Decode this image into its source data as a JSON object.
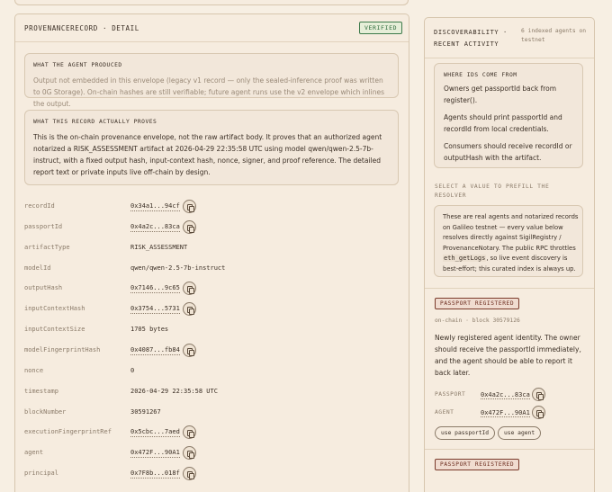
{
  "detail": {
    "title": "PROVENANCERECORD · DETAIL",
    "status": "VERIFIED",
    "produced": {
      "heading": "WHAT THE AGENT PRODUCED",
      "text": "Output not embedded in this envelope (legacy v1 record — only the sealed-inference proof was written to 0G Storage). On-chain hashes are still verifiable; future agent runs use the v2 envelope which inlines the output."
    },
    "proves": {
      "heading": "WHAT THIS RECORD ACTUALLY PROVES",
      "text": "This is the on-chain provenance envelope, not the raw artifact body. It proves that an authorized agent notarized a RISK_ASSESSMENT artifact at 2026-04-29 22:35:58 UTC using model qwen/qwen-2.5-7b-instruct, with a fixed output hash, input-context hash, nonce, signer, and proof reference. The detailed report text or private inputs live off-chain by design."
    },
    "fields": [
      {
        "key": "recordId",
        "value": "0x34a1...94cf",
        "copy": true
      },
      {
        "key": "passportId",
        "value": "0x4a2c...83ca",
        "copy": true
      },
      {
        "key": "artifactType",
        "value": "RISK_ASSESSMENT",
        "copy": false
      },
      {
        "key": "modelId",
        "value": "qwen/qwen-2.5-7b-instruct",
        "copy": false
      },
      {
        "key": "outputHash",
        "value": "0x7146...9c65",
        "copy": true
      },
      {
        "key": "inputContextHash",
        "value": "0x3754...5731",
        "copy": true
      },
      {
        "key": "inputContextSize",
        "value": "1705 bytes",
        "copy": false
      },
      {
        "key": "modelFingerprintHash",
        "value": "0x4087...fb84",
        "copy": true
      },
      {
        "key": "nonce",
        "value": "0",
        "copy": false
      },
      {
        "key": "timestamp",
        "value": "2026-04-29 22:35:58 UTC",
        "copy": false
      },
      {
        "key": "blockNumber",
        "value": "30591267",
        "copy": false
      },
      {
        "key": "executionFingerprintRef",
        "value": "0x5cbc...7aed",
        "copy": true
      },
      {
        "key": "agent",
        "value": "0x472F...90A1",
        "copy": true
      },
      {
        "key": "principal",
        "value": "0x7F8b...018f",
        "copy": true
      }
    ]
  },
  "activity": {
    "title": "DISCOVERABILITY · RECENT ACTIVITY",
    "subtitle": "6 indexed agents on testnet",
    "ids": {
      "heading": "WHERE IDS COME FROM",
      "p1": "Owners get passportId back from register().",
      "p2": "Agents should print passportId and recordId from local credentials.",
      "p3": "Consumers should receive recordId or outputHash with the artifact."
    },
    "prefill_label": "SELECT A VALUE TO PREFILL THE RESOLVER",
    "info_pre": "These are real agents and notarized records on Galileo testnet — every value below resolves directly against SigilRegistry / ProvenanceNotary. The public RPC throttles ",
    "info_code": "eth_getLogs",
    "info_post": ", so live event discovery is best-effort; this curated index is always up.",
    "event": {
      "badge": "PASSPORT REGISTERED",
      "chain": "on-chain · block 30579126",
      "description": "Newly registered agent identity. The owner should receive the passportId immediately, and the agent should be able to report it back later.",
      "passport_key": "PASSPORT",
      "passport_value": "0x4a2c...83ca",
      "agent_key": "AGENT",
      "agent_value": "0x472F...90A1",
      "use_passport_label": "use passportId",
      "use_agent_label": "use agent"
    },
    "event2_badge": "PASSPORT REGISTERED"
  }
}
